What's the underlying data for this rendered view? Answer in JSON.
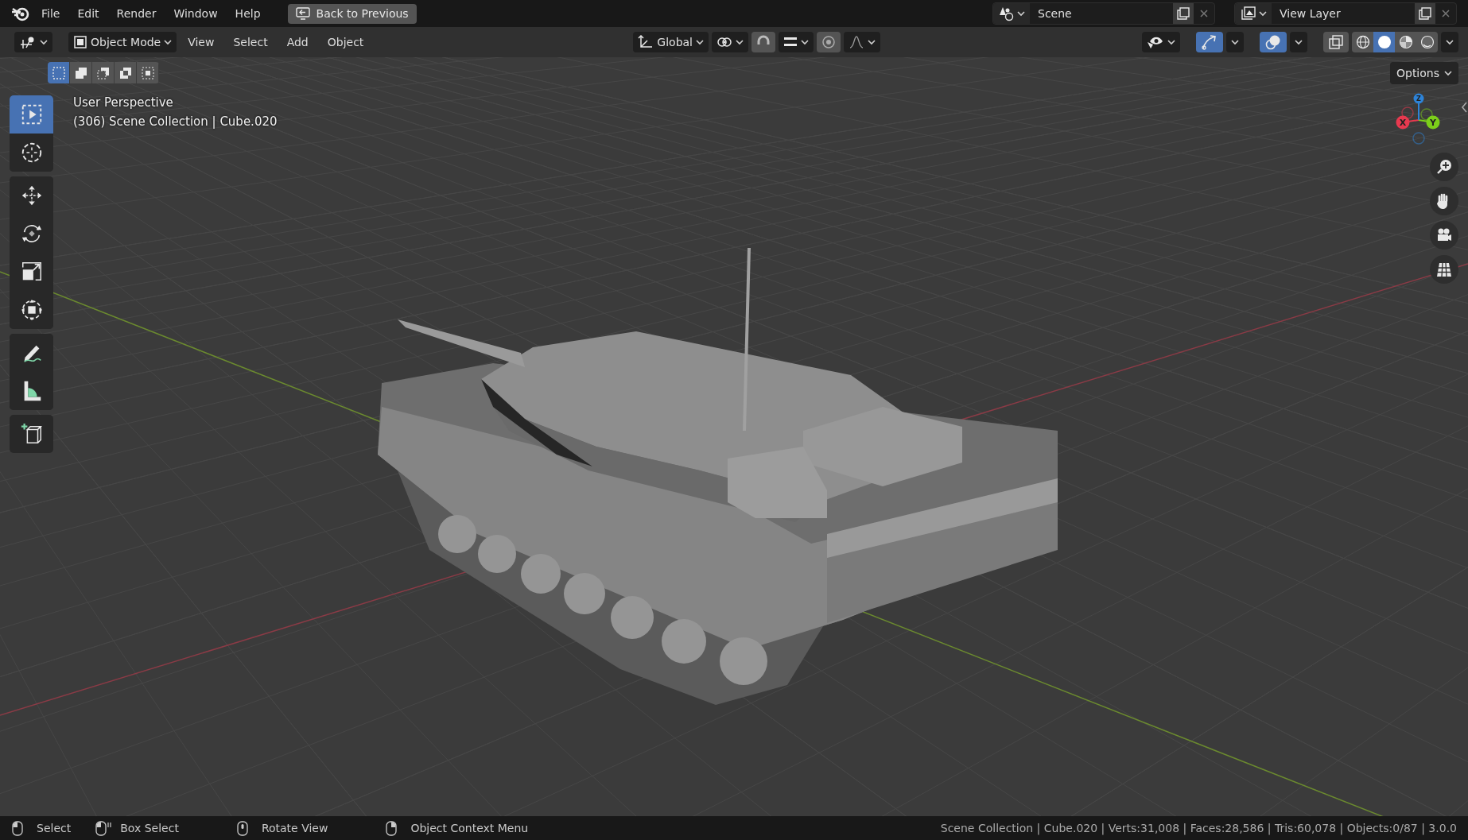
{
  "menu_bar": {
    "items": [
      "File",
      "Edit",
      "Render",
      "Window",
      "Help"
    ],
    "back_button": "Back to Previous",
    "scene": "Scene",
    "view_layer": "View Layer"
  },
  "header": {
    "mode": "Object Mode",
    "menus": [
      "View",
      "Select",
      "Add",
      "Object"
    ],
    "orientation": "Global",
    "gizmos_on": true,
    "overlays_on": true,
    "shading": [
      {
        "kind": "wireframe",
        "selected": false
      },
      {
        "kind": "solid",
        "selected": true
      },
      {
        "kind": "material",
        "selected": false
      },
      {
        "kind": "rendered",
        "selected": false
      }
    ]
  },
  "select_modes": [
    {
      "kind": "set",
      "selected": true
    },
    {
      "kind": "extend",
      "selected": false
    },
    {
      "kind": "subtract",
      "selected": false
    },
    {
      "kind": "difference",
      "selected": false
    },
    {
      "kind": "intersect",
      "selected": false
    }
  ],
  "options_button": "Options",
  "viewport": {
    "title": "User Perspective",
    "subtitle": "(306) Scene Collection | Cube.020"
  },
  "tools": [
    {
      "kind": "select-box",
      "selected": true
    },
    {
      "kind": "cursor",
      "selected": false
    },
    {
      "kind": "move",
      "selected": false
    },
    {
      "kind": "rotate",
      "selected": false
    },
    {
      "kind": "scale",
      "selected": false
    },
    {
      "kind": "transform",
      "selected": false
    },
    {
      "kind": "annotate",
      "selected": false
    },
    {
      "kind": "measure",
      "selected": false
    },
    {
      "kind": "add-cube",
      "selected": false
    }
  ],
  "gizmo": [
    {
      "label": "X",
      "color": "#e8394f"
    },
    {
      "label": "Y",
      "color": "#7ccf1a"
    },
    {
      "label": "Z",
      "color": "#2d83d8"
    }
  ],
  "navigation": [
    {
      "kind": "zoom"
    },
    {
      "kind": "pan"
    },
    {
      "kind": "camera"
    },
    {
      "kind": "ortho"
    }
  ],
  "status_bar": {
    "hints": [
      {
        "kind": "left",
        "label": "Select"
      },
      {
        "kind": "drag",
        "label": "Box Select"
      },
      {
        "kind": "middle",
        "label": "Rotate View"
      },
      {
        "kind": "right",
        "label": "Object Context Menu"
      }
    ],
    "stats": "Scene Collection | Cube.020 | Verts:31,008 | Faces:28,586 | Tris:60,078 | Objects:0/87 | 3.0.0"
  }
}
